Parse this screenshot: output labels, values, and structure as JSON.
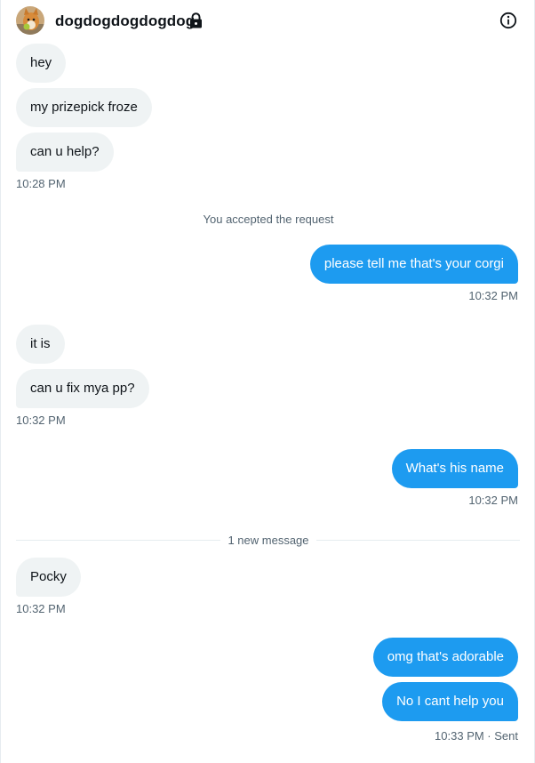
{
  "header": {
    "username": "dogdogdogdogdog",
    "avatar_icon": "corgi-avatar",
    "lock_icon": "lock-icon",
    "info_icon": "info-icon"
  },
  "colors": {
    "outgoing_bubble": "#1d9bf0",
    "incoming_bubble": "#eff3f4",
    "timestamp_text": "#536471"
  },
  "messages": {
    "m1": "hey",
    "m2": "my prizepick froze",
    "m3": "can u help?",
    "t1": "10:28 PM",
    "system": "You accepted the request",
    "m4": "please tell me that's your corgi",
    "t2": "10:32 PM",
    "m5": "it is",
    "m6": "can u fix mya pp?",
    "t3": "10:32 PM",
    "m7": "What's his name",
    "t4": "10:32 PM",
    "new_message_divider": "1 new message",
    "m8": "Pocky",
    "t5": "10:32 PM",
    "m9": "omg that's adorable",
    "m10": "No I cant help you",
    "t6": "10:33 PM · Sent"
  }
}
